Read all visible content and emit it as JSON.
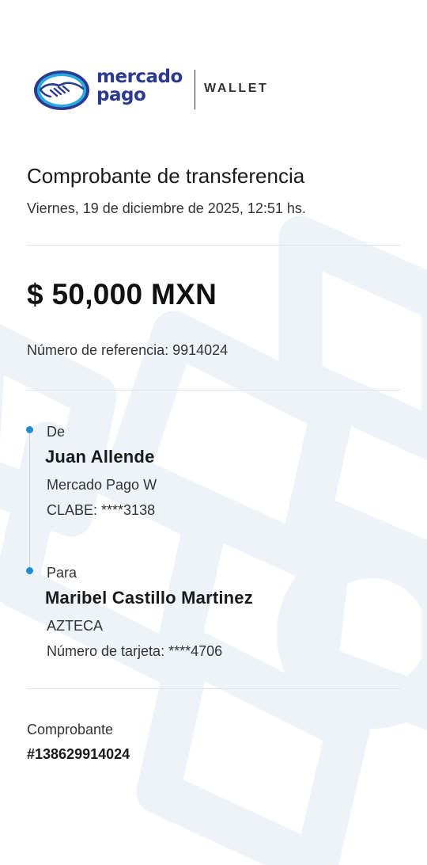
{
  "logo": {
    "brand_line1": "mercado",
    "brand_line2": "pago",
    "product": "WALLET",
    "icon": "handshake-icon",
    "colors": {
      "badge": "#29abe2",
      "brand_text": "#2b3a8f"
    }
  },
  "receipt": {
    "title": "Comprobante de transferencia",
    "datetime": "Viernes, 19 de diciembre de 2025, 12:51 hs.",
    "amount": "$ 50,000 MXN",
    "reference": "Número de referencia: 9914024"
  },
  "sender": {
    "label": "De",
    "name": "Juan Allende",
    "institution": "Mercado Pago W",
    "account": "CLABE: ****3138"
  },
  "recipient": {
    "label": "Para",
    "name": "Maribel Castillo Martinez",
    "institution": "AZTECA",
    "account": "Número de tarjeta: ****4706"
  },
  "voucher": {
    "label": "Comprobante",
    "number": "#138629914024"
  },
  "colors": {
    "timeline_dot": "#1f8dd6",
    "watermark": "#eef3fa"
  }
}
